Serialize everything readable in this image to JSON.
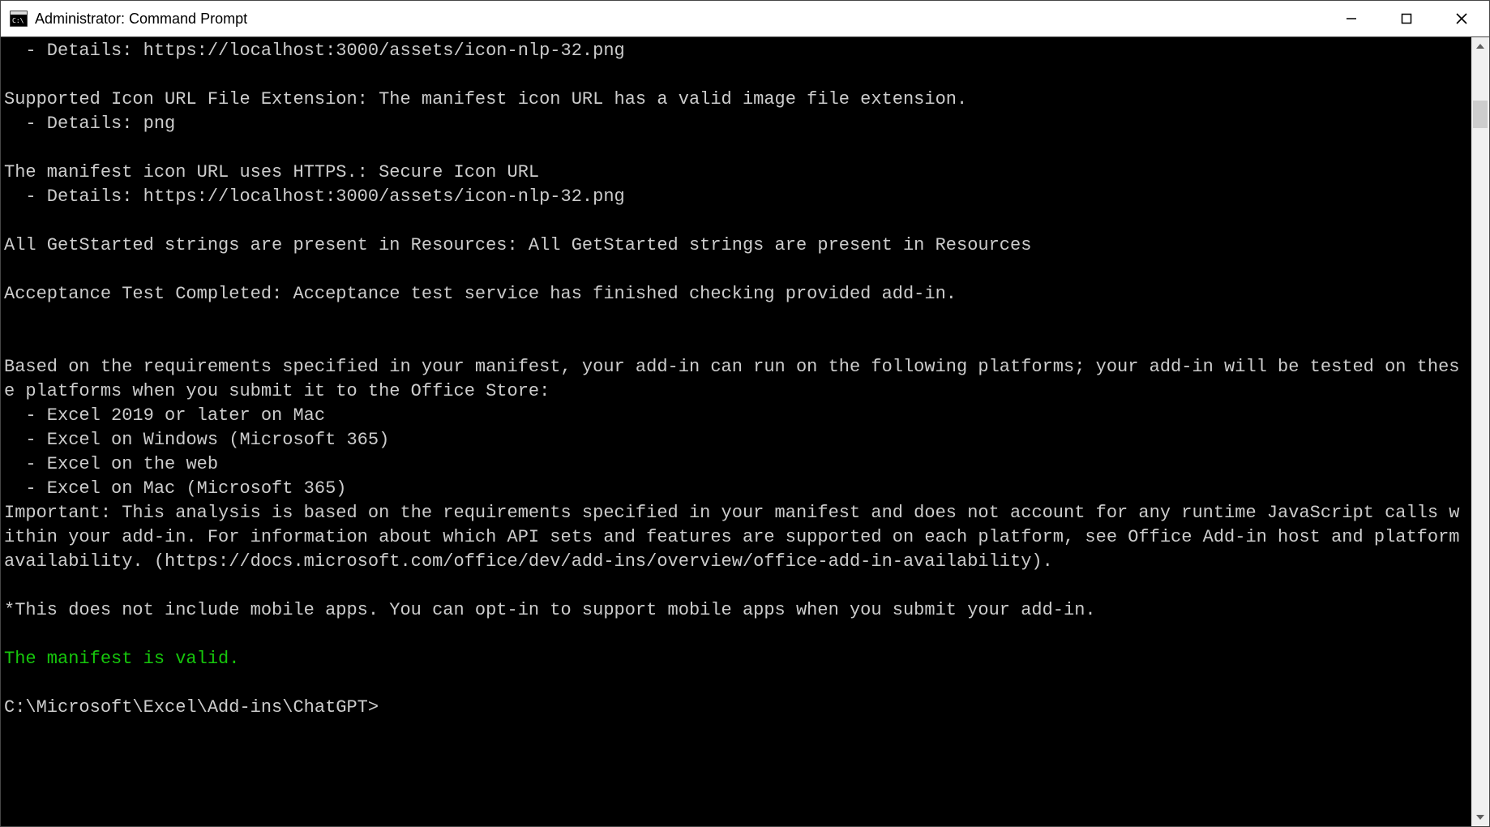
{
  "title": "Administrator: Command Prompt",
  "console_lines": [
    "  - Details: https://localhost:3000/assets/icon-nlp-32.png",
    "",
    "Supported Icon URL File Extension: The manifest icon URL has a valid image file extension.",
    "  - Details: png",
    "",
    "The manifest icon URL uses HTTPS.: Secure Icon URL",
    "  - Details: https://localhost:3000/assets/icon-nlp-32.png",
    "",
    "All GetStarted strings are present in Resources: All GetStarted strings are present in Resources",
    "",
    "Acceptance Test Completed: Acceptance test service has finished checking provided add-in.",
    "",
    "",
    "Based on the requirements specified in your manifest, your add-in can run on the following platforms; your add-in will be tested on these platforms when you submit it to the Office Store:",
    "  - Excel 2019 or later on Mac",
    "  - Excel on Windows (Microsoft 365)",
    "  - Excel on the web",
    "  - Excel on Mac (Microsoft 365)",
    "Important: This analysis is based on the requirements specified in your manifest and does not account for any runtime JavaScript calls within your add-in. For information about which API sets and features are supported on each platform, see Office Add-in host and platform availability. (https://docs.microsoft.com/office/dev/add-ins/overview/office-add-in-availability).",
    "",
    "*This does not include mobile apps. You can opt-in to support mobile apps when you submit your add-in.",
    ""
  ],
  "success_line": "The manifest is valid.",
  "prompt_line": "C:\\Microsoft\\Excel\\Add-ins\\ChatGPT>"
}
